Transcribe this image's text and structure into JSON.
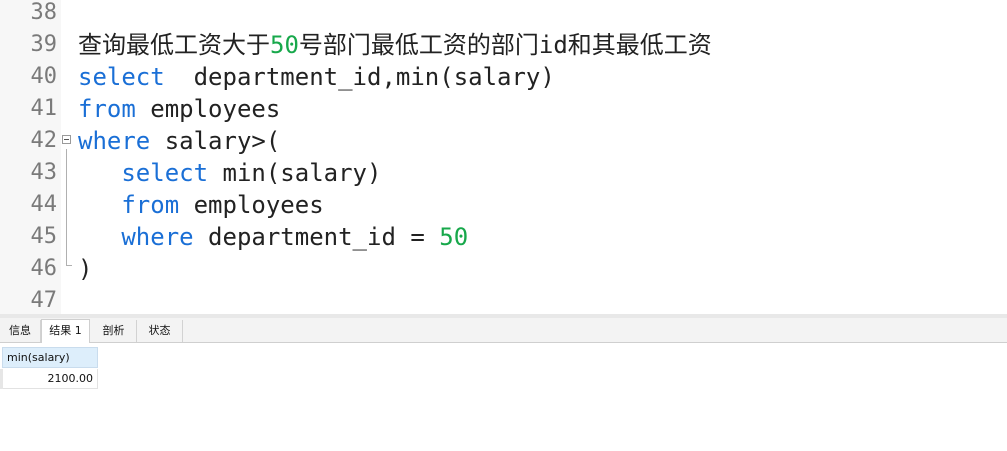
{
  "editor": {
    "lines": [
      {
        "num": "38",
        "tokens": []
      },
      {
        "num": "39",
        "tokens": [
          {
            "t": "查询最低工资大于",
            "c": "plain"
          },
          {
            "t": "50",
            "c": "num"
          },
          {
            "t": "号部门最低工资的部门id和其最低工资",
            "c": "plain"
          }
        ]
      },
      {
        "num": "40",
        "tokens": [
          {
            "t": "select",
            "c": "kw"
          },
          {
            "t": "  department_id,min(salary)",
            "c": "plain"
          }
        ]
      },
      {
        "num": "41",
        "tokens": [
          {
            "t": "from",
            "c": "kw"
          },
          {
            "t": " employees",
            "c": "plain"
          }
        ]
      },
      {
        "num": "42",
        "tokens": [
          {
            "t": "where",
            "c": "kw"
          },
          {
            "t": " salary>(",
            "c": "plain"
          }
        ]
      },
      {
        "num": "43",
        "tokens": [
          {
            "t": "   ",
            "c": "plain"
          },
          {
            "t": "select",
            "c": "kw"
          },
          {
            "t": " min(salary)",
            "c": "plain"
          }
        ]
      },
      {
        "num": "44",
        "tokens": [
          {
            "t": "   ",
            "c": "plain"
          },
          {
            "t": "from",
            "c": "kw"
          },
          {
            "t": " employees",
            "c": "plain"
          }
        ]
      },
      {
        "num": "45",
        "tokens": [
          {
            "t": "   ",
            "c": "plain"
          },
          {
            "t": "where",
            "c": "kw"
          },
          {
            "t": " department_id = ",
            "c": "plain"
          },
          {
            "t": "50",
            "c": "num"
          }
        ]
      },
      {
        "num": "46",
        "tokens": [
          {
            "t": ")",
            "c": "plain"
          }
        ]
      },
      {
        "num": "47",
        "tokens": []
      }
    ],
    "colors": {
      "keyword": "#1a6fd6",
      "number": "#17a84b",
      "text": "#222222"
    }
  },
  "tabs": {
    "info": "信息",
    "result1": "结果 1",
    "profile": "剖析",
    "status": "状态"
  },
  "result": {
    "column": "min(salary)",
    "value": "2100.00"
  }
}
